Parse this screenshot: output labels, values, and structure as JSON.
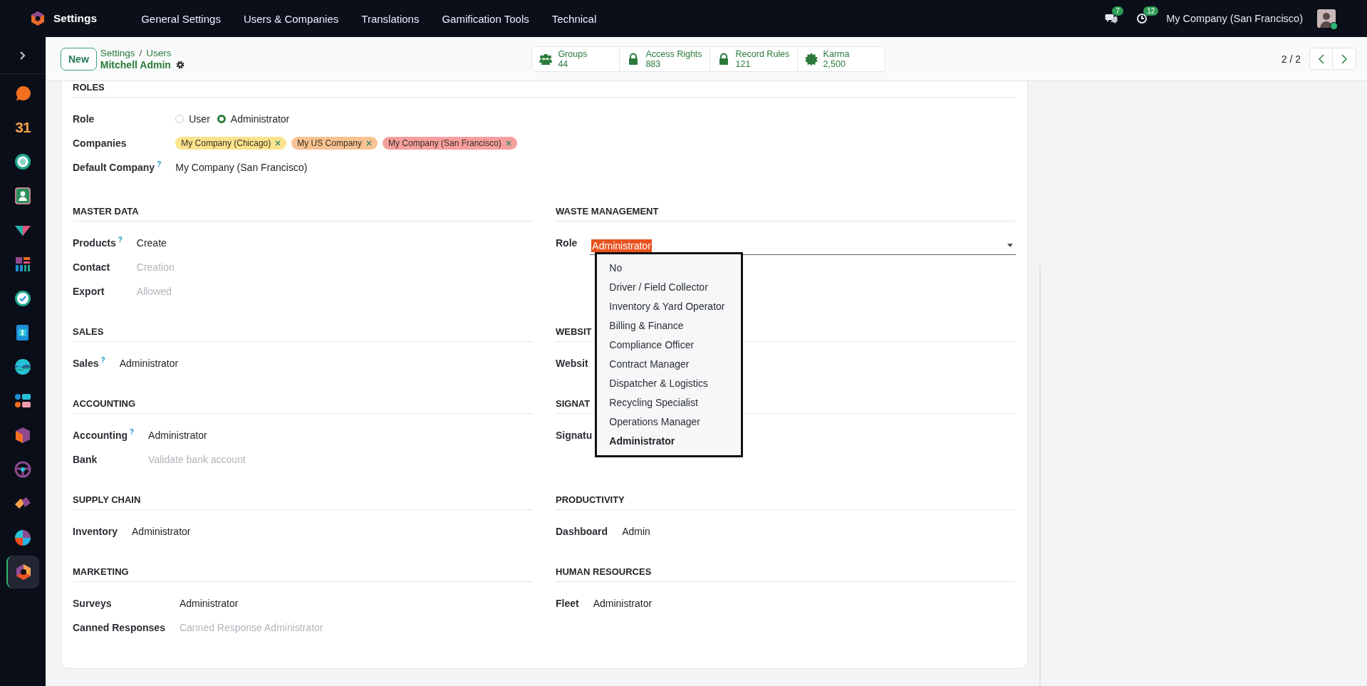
{
  "top_bar": {
    "app_name": "Settings",
    "menu": [
      "General Settings",
      "Users & Companies",
      "Translations",
      "Gamification Tools",
      "Technical"
    ],
    "messages_count": "7",
    "activities_count": "12",
    "company": "My Company (San Francisco)",
    "avatar_online": true
  },
  "sidebar": {
    "items": [
      {
        "selected": false
      },
      {
        "selected": false,
        "glyph": "31"
      },
      {
        "selected": false
      },
      {
        "selected": false
      },
      {
        "selected": false
      },
      {
        "selected": false
      },
      {
        "selected": false
      },
      {
        "selected": false
      },
      {
        "selected": false
      },
      {
        "selected": false
      },
      {
        "selected": false
      },
      {
        "selected": false
      },
      {
        "selected": false
      },
      {
        "selected": false
      },
      {
        "selected": true
      }
    ]
  },
  "control_panel": {
    "new_button": "New",
    "breadcrumbs": [
      {
        "label": "Settings"
      },
      {
        "label": "Users"
      }
    ],
    "separator": "/",
    "record_title": "Mitchell Admin",
    "stat_buttons": [
      {
        "label": "Groups",
        "value": "44"
      },
      {
        "label": "Access Rights",
        "value": "883"
      },
      {
        "label": "Record Rules",
        "value": "121"
      },
      {
        "label": "Karma",
        "value": "2,500"
      }
    ],
    "pager": "2 / 2"
  },
  "roles": {
    "title": "ROLES",
    "fields": [
      {
        "kind": "radio",
        "label": "Role",
        "options": [
          {
            "label": "User",
            "selected": false
          },
          {
            "label": "Administrator",
            "selected": true
          }
        ]
      },
      {
        "kind": "tags",
        "label": "Companies",
        "tags": [
          {
            "label": "My Company (Chicago)",
            "color": "#fbe38e"
          },
          {
            "label": "My US Company",
            "color": "#f7c393"
          },
          {
            "label": "My Company (San Francisco)",
            "color": "#f6a09e"
          }
        ]
      },
      {
        "kind": "text",
        "label": "Default Company",
        "help": "?",
        "value": "My Company (San Francisco)"
      }
    ]
  },
  "sections": [
    {
      "title": "MASTER DATA",
      "fields": [
        {
          "kind": "text",
          "label": "Products",
          "help": "?",
          "value": "Create"
        },
        {
          "kind": "text",
          "label": "Contact",
          "placeholder": "Creation"
        },
        {
          "kind": "text",
          "label": "Export",
          "placeholder": "Allowed"
        }
      ]
    },
    {
      "title": "WASTE MANAGEMENT",
      "fields": [
        {
          "kind": "select",
          "label": "Role",
          "value": "Administrator",
          "highlighted": true,
          "open": true,
          "options": [
            {
              "label": "No",
              "selected": false
            },
            {
              "label": "Driver / Field Collector",
              "selected": false
            },
            {
              "label": "Inventory & Yard Operator",
              "selected": false
            },
            {
              "label": "Billing & Finance",
              "selected": false
            },
            {
              "label": "Compliance Officer",
              "selected": false
            },
            {
              "label": "Contract Manager",
              "selected": false
            },
            {
              "label": "Dispatcher & Logistics",
              "selected": false
            },
            {
              "label": "Recycling Specialist",
              "selected": false
            },
            {
              "label": "Operations Manager",
              "selected": false
            },
            {
              "label": "Administrator",
              "selected": true
            }
          ]
        }
      ]
    },
    {
      "title": "SALES",
      "fields": [
        {
          "kind": "text",
          "label": "Sales",
          "help": "?",
          "value": "Administrator"
        }
      ]
    },
    {
      "title": "WEBSIT",
      "fields": [
        {
          "kind": "label",
          "label": "Websit"
        }
      ]
    },
    {
      "title": "ACCOUNTING",
      "fields": [
        {
          "kind": "text",
          "label": "Accounting",
          "help": "?",
          "value": "Administrator"
        },
        {
          "kind": "text",
          "label": "Bank",
          "placeholder": "Validate bank account"
        }
      ]
    },
    {
      "title": "SIGNAT",
      "fields": [
        {
          "kind": "label",
          "label": "Signatu"
        }
      ]
    },
    {
      "title": "SUPPLY CHAIN",
      "fields": [
        {
          "kind": "text",
          "label": "Inventory",
          "value": "Administrator"
        }
      ]
    },
    {
      "title": "PRODUCTIVITY",
      "fields": [
        {
          "kind": "text",
          "label": "Dashboard",
          "value": "Admin"
        }
      ]
    },
    {
      "title": "MARKETING",
      "fields": [
        {
          "kind": "text",
          "label": "Surveys",
          "value": "Administrator"
        },
        {
          "kind": "text",
          "label": "Canned Responses",
          "placeholder": "Canned Response Administrator"
        }
      ]
    },
    {
      "title": "HUMAN RESOURCES",
      "fields": [
        {
          "kind": "text",
          "label": "Fleet",
          "value": "Administrator"
        }
      ]
    }
  ]
}
